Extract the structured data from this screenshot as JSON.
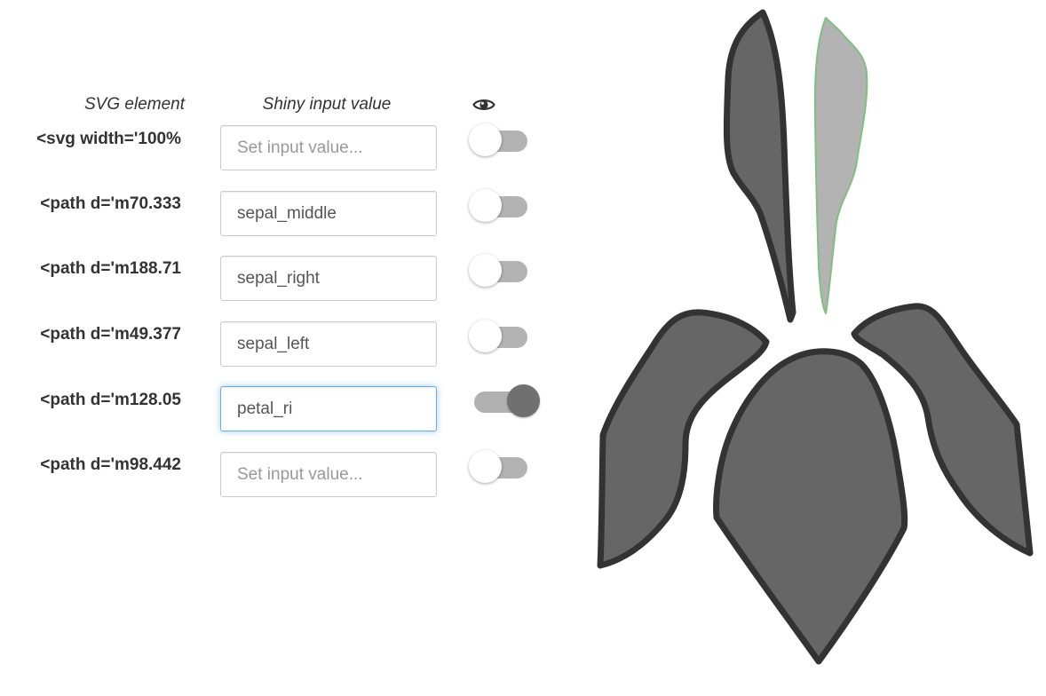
{
  "headers": {
    "svg_element": "SVG element",
    "input_value": "Shiny input value",
    "visibility_icon": "eye-icon"
  },
  "rows": [
    {
      "svg_element": "<svg width='100%",
      "input_value": "",
      "placeholder": "Set input value...",
      "visible": false,
      "focused": false
    },
    {
      "svg_element": "<path d='m70.333",
      "input_value": "sepal_middle",
      "placeholder": "Set input value...",
      "visible": false,
      "focused": false
    },
    {
      "svg_element": "<path d='m188.71",
      "input_value": "sepal_right",
      "placeholder": "Set input value...",
      "visible": false,
      "focused": false
    },
    {
      "svg_element": "<path d='m49.377",
      "input_value": "sepal_left",
      "placeholder": "Set input value...",
      "visible": false,
      "focused": false
    },
    {
      "svg_element": "<path d='m128.05",
      "input_value": "petal_ri",
      "placeholder": "Set input value...",
      "visible": true,
      "focused": true
    },
    {
      "svg_element": "<path d='m98.442",
      "input_value": "",
      "placeholder": "Set input value...",
      "visible": false,
      "focused": false
    }
  ],
  "colors": {
    "part_fill": "#666666",
    "part_stroke": "#333333",
    "selected_part_fill": "#b3b3b3",
    "selected_part_stroke": "#7fbf7f",
    "focus_border": "#66afe9"
  }
}
